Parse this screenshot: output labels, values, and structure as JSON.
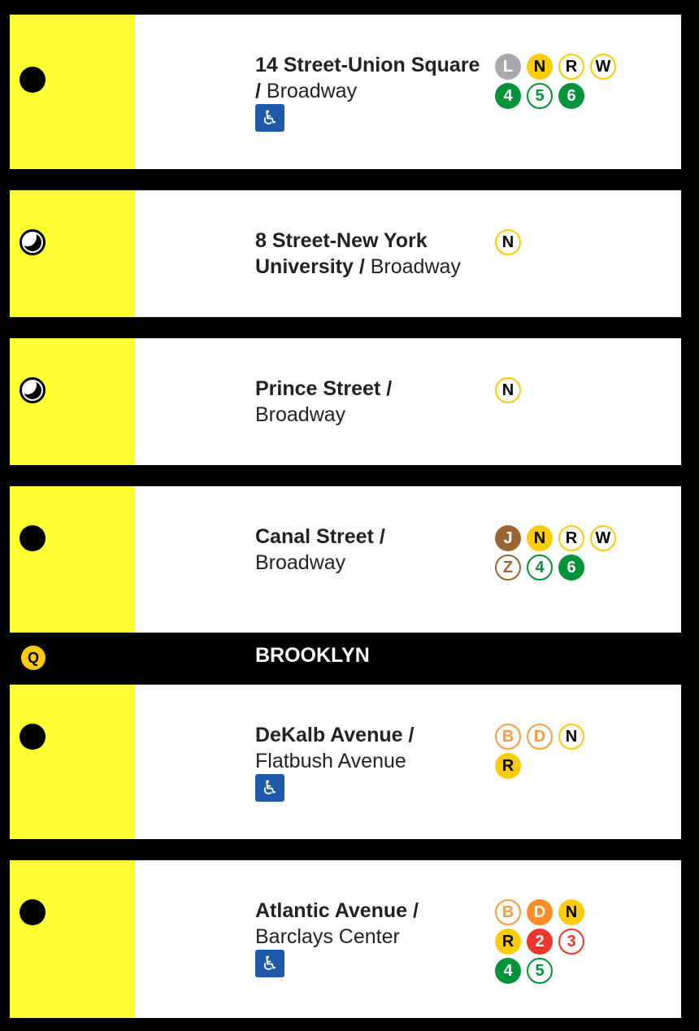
{
  "colors": {
    "stripe": "#ffff33",
    "ada_bg": "#1e5aa8"
  },
  "stations": [
    {
      "name": "14 Street-Union Square",
      "separator": " / ",
      "street": "Broadway",
      "stop_type": "full-time",
      "accessible": true,
      "ada_icon": "wheelchair-icon",
      "routes": [
        {
          "label": "L",
          "style": "filled",
          "color": "#a7a9ac",
          "text": "#fff"
        },
        {
          "label": "N",
          "style": "filled",
          "color": "#fccc0a",
          "text": "#000"
        },
        {
          "label": "R",
          "style": "outline",
          "color": "#fccc0a",
          "text": "#000"
        },
        {
          "label": "W",
          "style": "outline",
          "color": "#fccc0a",
          "text": "#000"
        },
        {
          "label": "4",
          "style": "filled",
          "color": "#00933c",
          "text": "#fff"
        },
        {
          "label": "5",
          "style": "outline",
          "color": "#00933c",
          "text": "#00933c"
        },
        {
          "label": "6",
          "style": "filled",
          "color": "#00933c",
          "text": "#fff"
        }
      ]
    },
    {
      "name": "8 Street-New York University",
      "separator": " / ",
      "street": "Broadway",
      "stop_type": "late-night",
      "accessible": false,
      "routes": [
        {
          "label": "N",
          "style": "outline",
          "color": "#fccc0a",
          "text": "#000"
        }
      ]
    },
    {
      "name": "Prince Street",
      "separator": " / ",
      "street": "Broadway",
      "stop_type": "late-night",
      "accessible": false,
      "routes": [
        {
          "label": "N",
          "style": "outline",
          "color": "#fccc0a",
          "text": "#000"
        }
      ]
    },
    {
      "name": "Canal Street",
      "separator": " / ",
      "street": "Broadway",
      "stop_type": "full-time",
      "accessible": false,
      "routes": [
        {
          "label": "J",
          "style": "filled",
          "color": "#996633",
          "text": "#fff"
        },
        {
          "label": "N",
          "style": "filled",
          "color": "#fccc0a",
          "text": "#000"
        },
        {
          "label": "R",
          "style": "outline",
          "color": "#fccc0a",
          "text": "#000"
        },
        {
          "label": "W",
          "style": "outline",
          "color": "#fccc0a",
          "text": "#000"
        },
        {
          "label": "Z",
          "style": "outline",
          "color": "#996633",
          "text": "#996633"
        },
        {
          "label": "4",
          "style": "outline",
          "color": "#00933c",
          "text": "#00933c"
        },
        {
          "label": "6",
          "style": "filled",
          "color": "#00933c",
          "text": "#fff"
        }
      ]
    },
    {
      "name": "DeKalb Avenue",
      "separator": " / ",
      "street": "Flatbush Avenue",
      "stop_type": "full-time",
      "accessible": true,
      "ada_icon": "wheelchair-icon",
      "routes": [
        {
          "label": "B",
          "style": "outline",
          "color": "#ff9a3d",
          "text": "#ff9a3d"
        },
        {
          "label": "D",
          "style": "outline",
          "color": "#ff9a3d",
          "text": "#ff9a3d"
        },
        {
          "label": "N",
          "style": "outline",
          "color": "#fccc0a",
          "text": "#000"
        },
        {
          "label": "R",
          "style": "filled",
          "color": "#fccc0a",
          "text": "#000"
        }
      ]
    },
    {
      "name": "Atlantic Avenue",
      "separator": " / ",
      "street": "Barclays Center",
      "stop_type": "full-time",
      "accessible": true,
      "ada_icon": "wheelchair-icon",
      "routes": [
        {
          "label": "B",
          "style": "outline",
          "color": "#ff9a3d",
          "text": "#ff9a3d"
        },
        {
          "label": "D",
          "style": "filled",
          "color": "#ff8c24",
          "text": "#fff"
        },
        {
          "label": "N",
          "style": "filled",
          "color": "#fccc0a",
          "text": "#000"
        },
        {
          "label": "R",
          "style": "filled",
          "color": "#fccc0a",
          "text": "#000"
        },
        {
          "label": "2",
          "style": "filled",
          "color": "#ee352e",
          "text": "#fff"
        },
        {
          "label": "3",
          "style": "outline",
          "color": "#ee352e",
          "text": "#ee352e"
        },
        {
          "label": "4",
          "style": "filled",
          "color": "#00933c",
          "text": "#fff"
        },
        {
          "label": "5",
          "style": "outline",
          "color": "#00933c",
          "text": "#00933c"
        }
      ]
    }
  ],
  "borough_separator": {
    "line_bullet": "Q",
    "label": "BROOKLYN"
  },
  "symbol": "wheelchair-icon",
  "wheelchair_glyph": "♿"
}
